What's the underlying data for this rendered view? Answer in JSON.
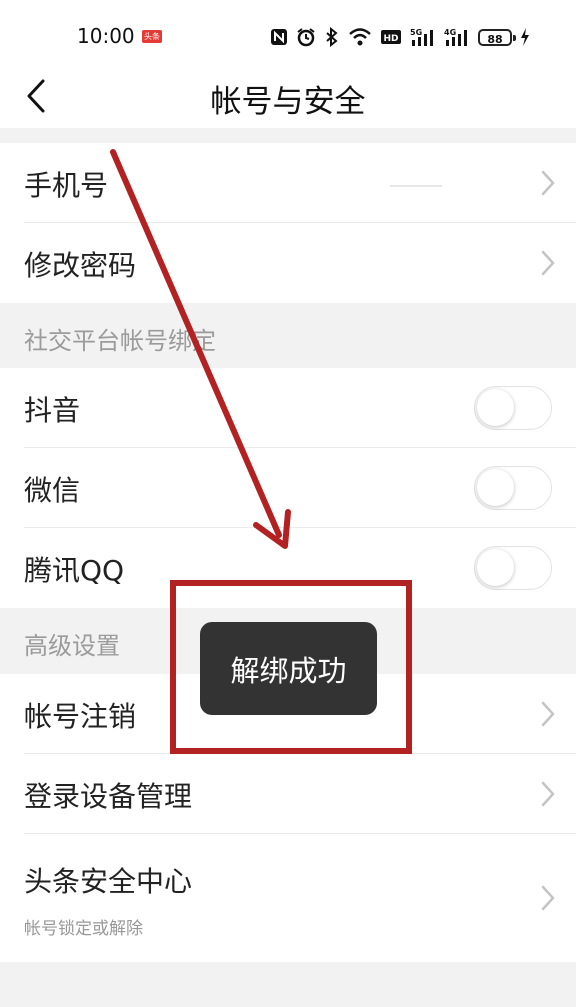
{
  "status_bar": {
    "time": "10:00",
    "app_badge": "头条",
    "battery": "88"
  },
  "header": {
    "title": "帐号与安全"
  },
  "account": {
    "phone_label": "手机号",
    "change_password_label": "修改密码"
  },
  "social": {
    "section_title": "社交平台帐号绑定",
    "items": [
      {
        "label": "抖音",
        "bound": false
      },
      {
        "label": "微信",
        "bound": false
      },
      {
        "label": "腾讯QQ",
        "bound": false
      }
    ]
  },
  "advanced": {
    "section_title": "高级设置",
    "deactivate_label": "帐号注销",
    "device_manage_label": "登录设备管理",
    "security_center_label": "头条安全中心",
    "security_center_sublabel": "帐号锁定或解除"
  },
  "toast": {
    "message": "解绑成功"
  },
  "colors": {
    "annotation": "#b22222",
    "toast_bg": "#333333",
    "page_bg": "#f2f2f2"
  }
}
